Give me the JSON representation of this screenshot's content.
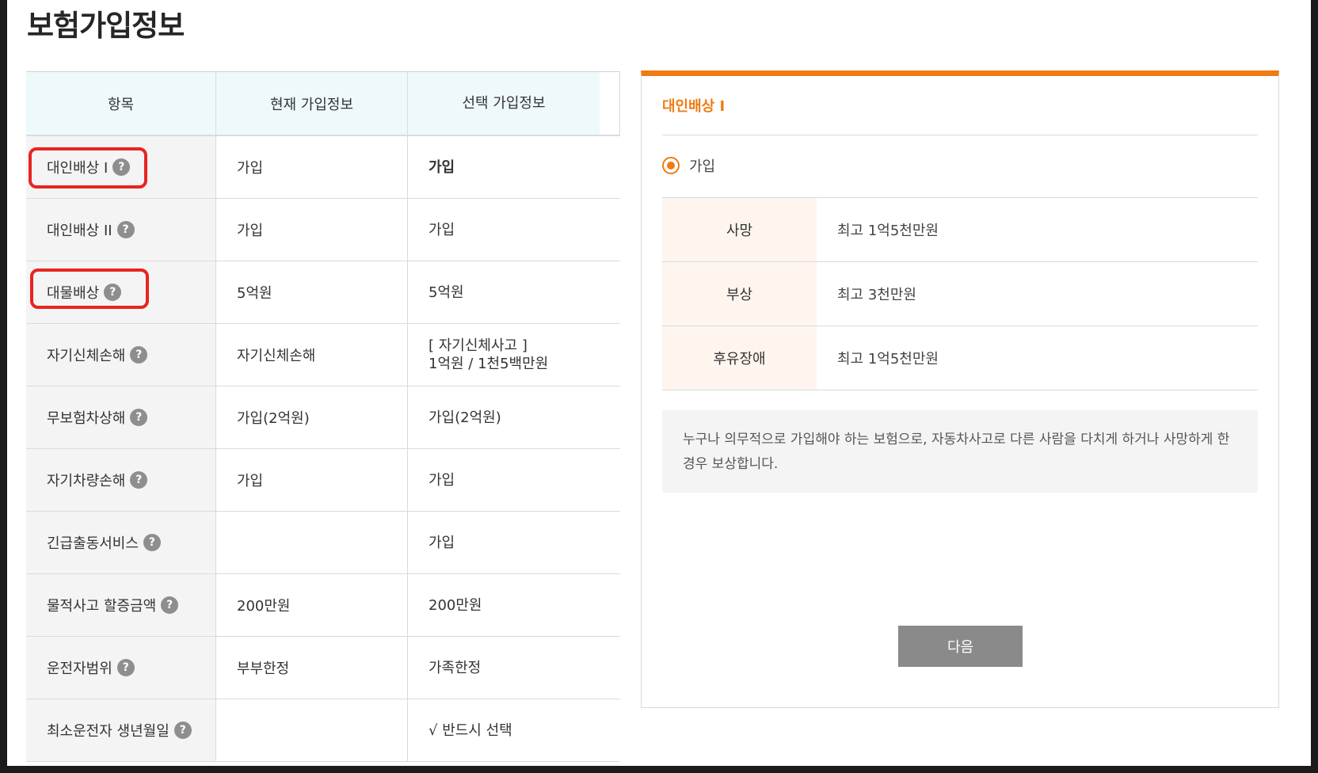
{
  "page": {
    "title": "보험가입정보"
  },
  "table": {
    "headers": [
      "항목",
      "현재 가입정보",
      "선택 가입정보"
    ],
    "rows": [
      {
        "item": "대인배상 I",
        "current": "가입",
        "selected": "가입",
        "selected_line2": ""
      },
      {
        "item": "대인배상 II",
        "current": "가입",
        "selected": "가입",
        "selected_line2": ""
      },
      {
        "item": "대물배상",
        "current": "5억원",
        "selected": "5억원",
        "selected_line2": ""
      },
      {
        "item": "자기신체손해",
        "current": "자기신체손해",
        "selected": "[ 자기신체사고 ]",
        "selected_line2": "1억원 / 1천5백만원"
      },
      {
        "item": "무보험차상해",
        "current": "가입(2억원)",
        "selected": "가입(2억원)",
        "selected_line2": ""
      },
      {
        "item": "자기차량손해",
        "current": "가입",
        "selected": "가입",
        "selected_line2": ""
      },
      {
        "item": "긴급출동서비스",
        "current": "",
        "selected": "가입",
        "selected_line2": ""
      },
      {
        "item": "물적사고 할증금액",
        "current": "200만원",
        "selected": "200만원",
        "selected_line2": ""
      },
      {
        "item": "운전자범위",
        "current": "부부한정",
        "selected": "가족한정",
        "selected_line2": ""
      },
      {
        "item": "최소운전자 생년월일",
        "current": "",
        "selected": "√ 반드시 선택",
        "selected_line2": ""
      }
    ],
    "help_icon": "question-mark-icon",
    "help_glyph": "?"
  },
  "panel": {
    "title": "대인배상 I",
    "radio_label": "가입",
    "coverage": [
      {
        "label": "사망",
        "value": "최고 1억5천만원"
      },
      {
        "label": "부상",
        "value": "최고 3천만원"
      },
      {
        "label": "후유장애",
        "value": "최고 1억5천만원"
      }
    ],
    "description": "누구나 의무적으로 가입해야 하는 보험으로, 자동차사고로 다른 사람을 다치게 하거나 사망하게 한 경우 보상합니다.",
    "next_button": "다음"
  },
  "colors": {
    "accent": "#f07b12",
    "highlight_box": "#e8251f",
    "header_bg": "#eef9fc",
    "button_bg": "#8a8a8a"
  }
}
